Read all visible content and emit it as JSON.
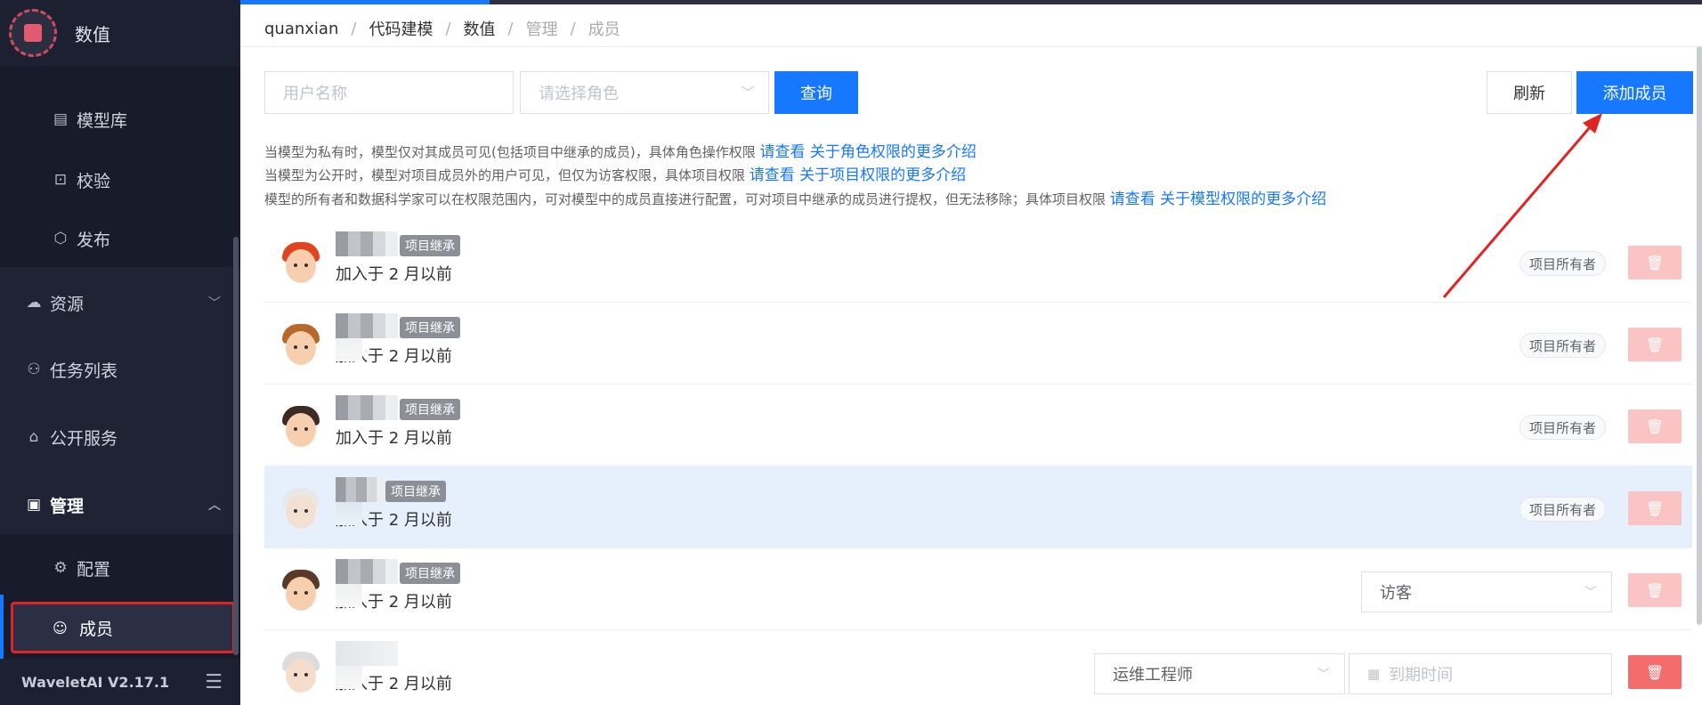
{
  "sidebar": {
    "app_title": "数值",
    "sub_items": [
      {
        "label": "模型库",
        "icon": "model-library-icon",
        "glyph": "▤"
      },
      {
        "label": "校验",
        "icon": "check-icon",
        "glyph": "⊡"
      },
      {
        "label": "发布",
        "icon": "publish-icon",
        "glyph": "⬡"
      }
    ],
    "resources": {
      "label": "资源",
      "glyph": "☁"
    },
    "tasks": {
      "label": "任务列表",
      "glyph": "⚇"
    },
    "public_services": {
      "label": "公开服务",
      "glyph": "⌂"
    },
    "management": {
      "label": "管理",
      "glyph": "▣"
    },
    "config": {
      "label": "配置",
      "glyph": "⚙"
    },
    "members": {
      "label": "成员",
      "glyph": "☺"
    },
    "version": "WaveletAI V2.17.1"
  },
  "breadcrumb": [
    "quanxian",
    "代码建模",
    "数值",
    "管理",
    "成员"
  ],
  "filters": {
    "username_placeholder": "用户名称",
    "role_placeholder": "请选择角色",
    "query_label": "查询",
    "refresh_label": "刷新",
    "add_member_label": "添加成员"
  },
  "notices": [
    {
      "text": "当模型为私有时，模型仅对其成员可见(包括项目中继承的成员)，具体角色操作权限 ",
      "link": "请查看 关于角色权限的更多介绍"
    },
    {
      "text": "当模型为公开时，模型对项目成员外的用户可见，但仅为访客权限，具体项目权限 ",
      "link": "请查看 关于项目权限的更多介绍"
    },
    {
      "text": "模型的所有者和数据科学家可以在权限范围内，可对模型中的成员直接进行配置，可对项目中继承的成员进行提权，但无法移除；具体项目权限 ",
      "link": "请查看 关于模型权限的更多介绍"
    }
  ],
  "members": [
    {
      "badge": "项目继承",
      "joined": "加入于 2 月以前",
      "role_tag": "项目所有者",
      "hair": "#e0451f",
      "highlight": false
    },
    {
      "badge": "项目继承",
      "joined": "加入于 2 月以前",
      "role_tag": "项目所有者",
      "hair": "#b8692a",
      "highlight": false
    },
    {
      "badge": "项目继承",
      "joined": "加入于 2 月以前",
      "role_tag": "项目所有者",
      "hair": "#3b2b24",
      "highlight": false
    },
    {
      "badge": "项目继承",
      "joined": "加入于 2 月以前",
      "role_tag": "项目所有者",
      "hair": "#e8e8e8",
      "highlight": true
    },
    {
      "badge": "项目继承",
      "joined": "加入于 2 月以前",
      "role_select": "访客",
      "hair": "#5a3a26",
      "highlight": false
    },
    {
      "joined": "加入于 2 月以前",
      "role_select": "运维工程师",
      "expire_placeholder": "到期时间",
      "hair": "#dcdcdc",
      "highlight": false
    }
  ],
  "colors": {
    "primary": "#1677ff",
    "danger": "#f56c6c",
    "danger_light": "#fbc4c4",
    "sidebar_bg": "#1f2334",
    "highlight_border": "#e02424"
  }
}
